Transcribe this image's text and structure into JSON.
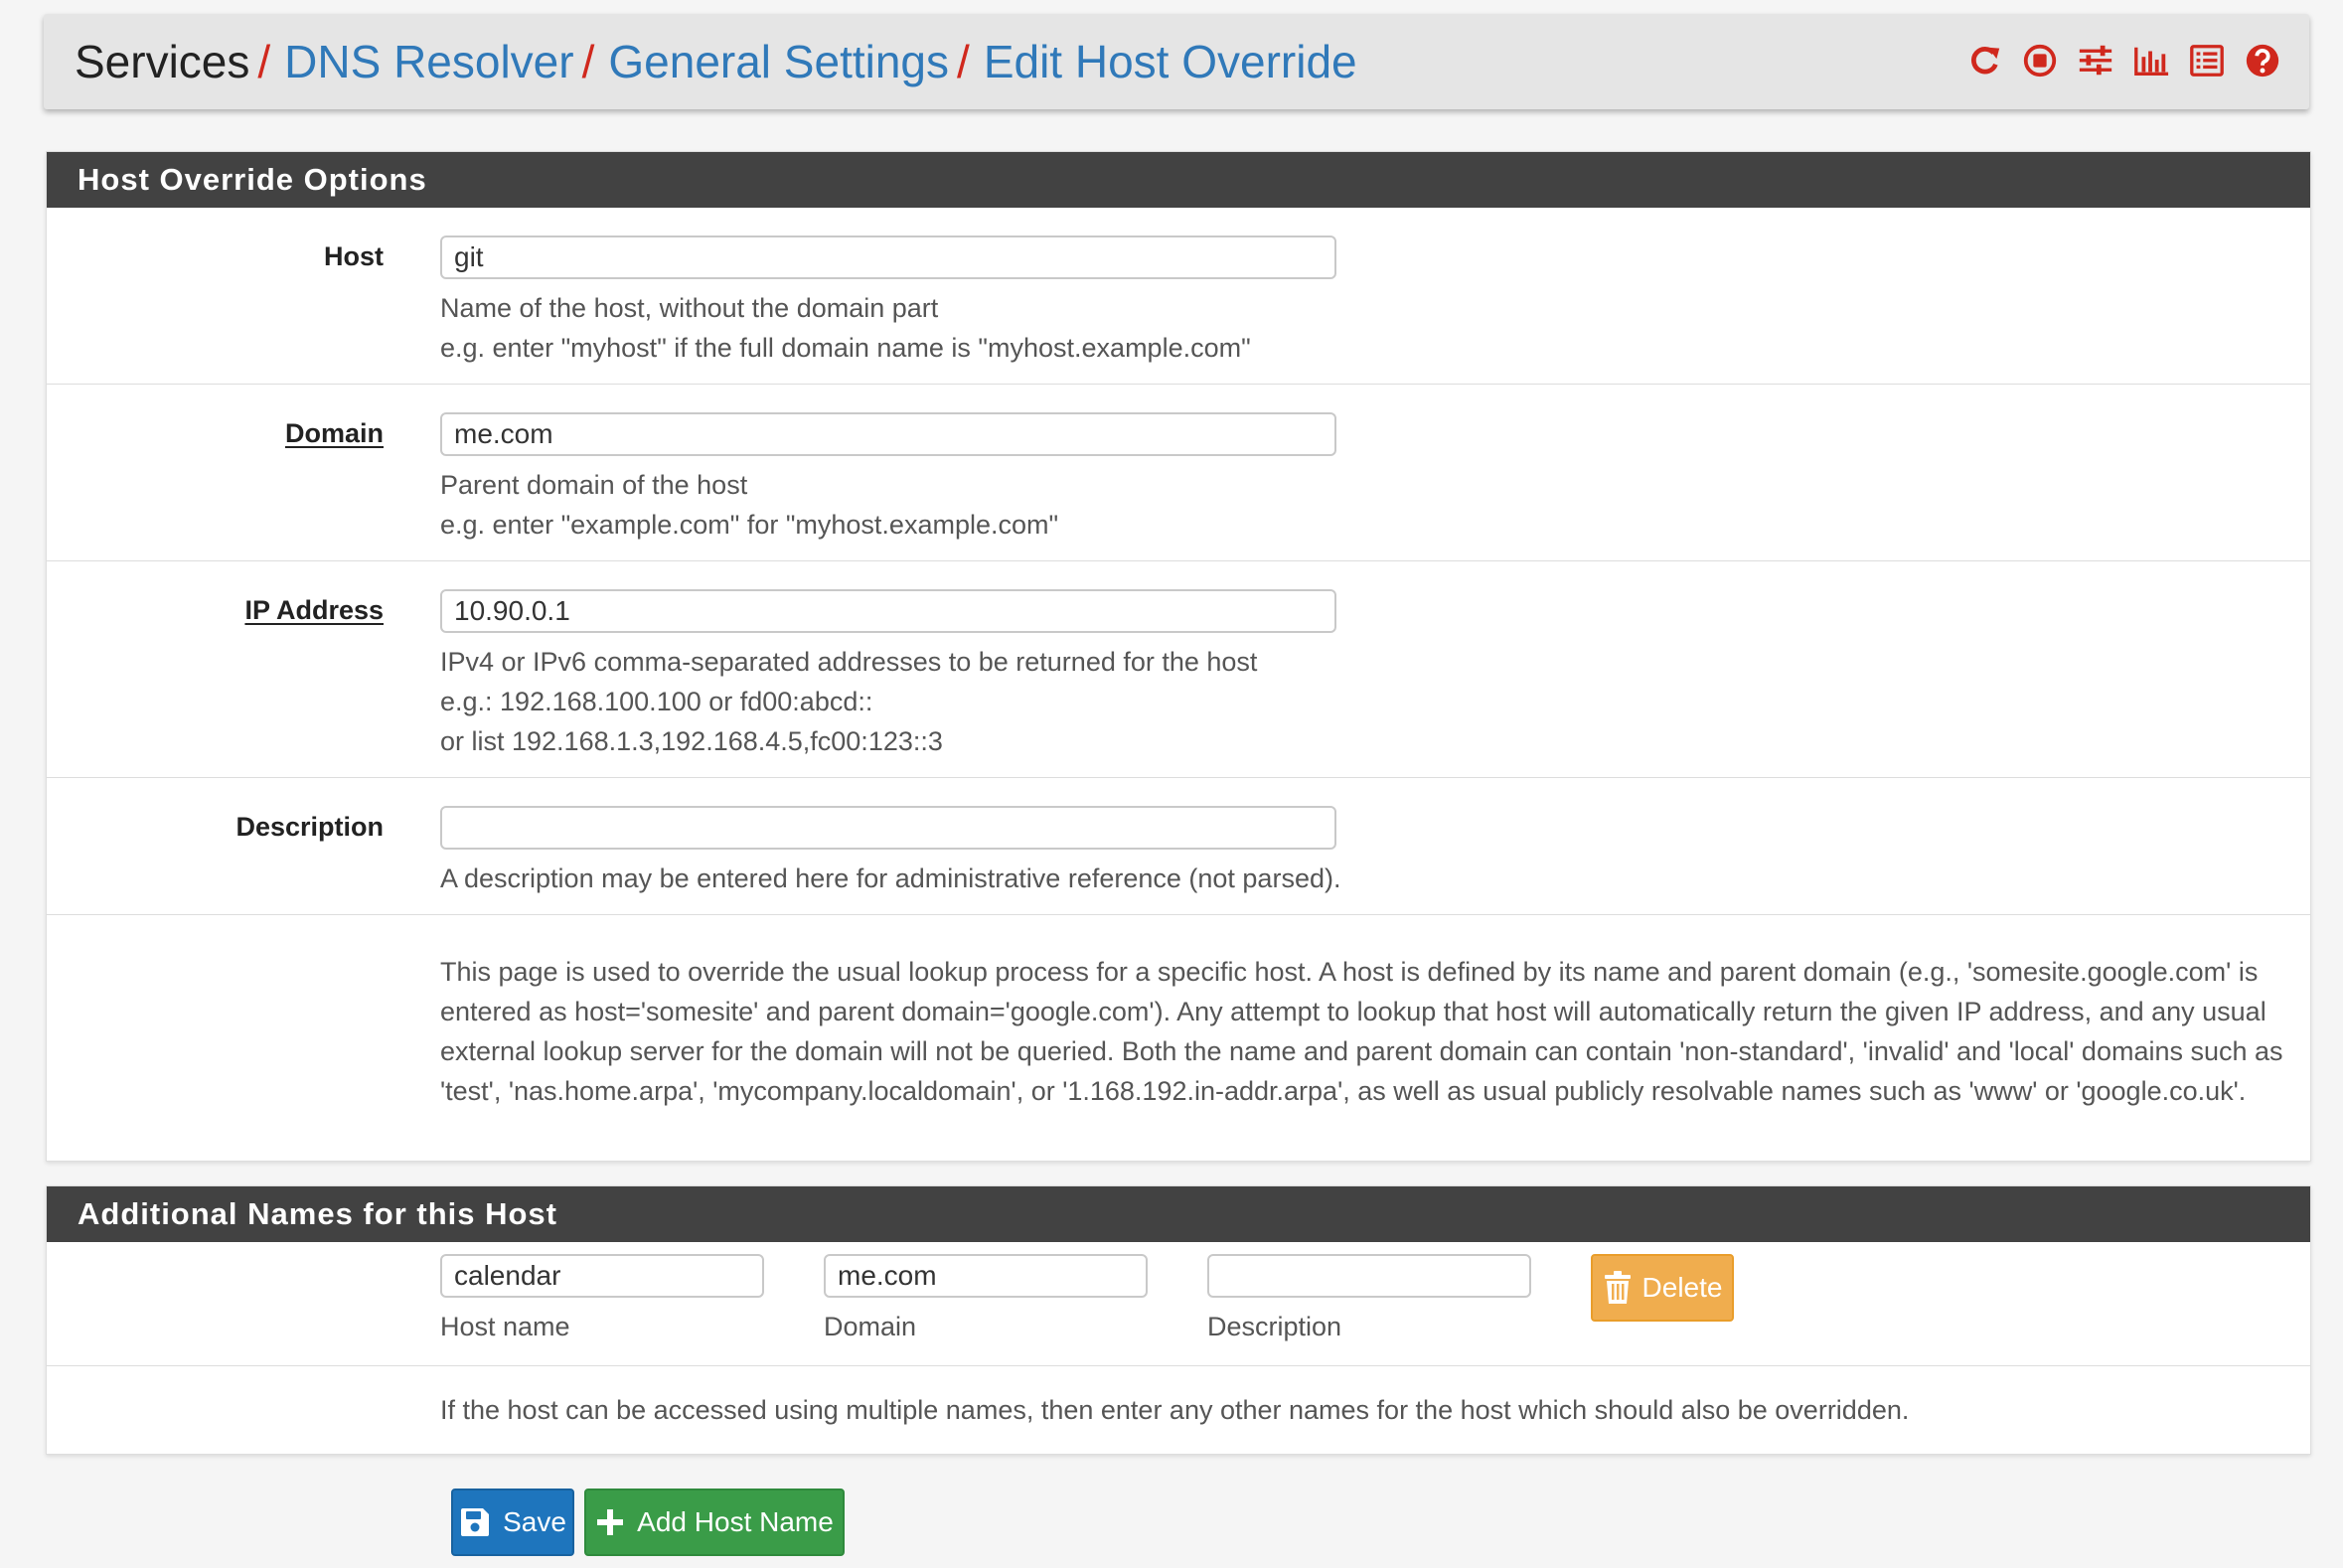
{
  "breadcrumb": {
    "items": [
      "Services",
      "DNS Resolver",
      "General Settings",
      "Edit Host Override"
    ],
    "separator": "/"
  },
  "toolbar": {
    "icons": [
      "restart-icon",
      "stop-icon",
      "settings-sliders-icon",
      "status-chart-icon",
      "log-list-icon",
      "help-icon"
    ],
    "icon_color": "#d0281d"
  },
  "host_override": {
    "heading": "Host Override Options",
    "host": {
      "label": "Host",
      "value": "git",
      "help1": "Name of the host, without the domain part",
      "help2": "e.g. enter \"myhost\" if the full domain name is \"myhost.example.com\""
    },
    "domain": {
      "label": "Domain",
      "value": "me.com",
      "help1": "Parent domain of the host",
      "help2": "e.g. enter \"example.com\" for \"myhost.example.com\""
    },
    "ip": {
      "label": "IP Address",
      "value": "10.90.0.1",
      "help1": "IPv4 or IPv6 comma-separated addresses to be returned for the host",
      "help2": "e.g.: 192.168.100.100 or fd00:abcd::",
      "help3": "or list 192.168.1.3,192.168.4.5,fc00:123::3"
    },
    "description": {
      "label": "Description",
      "value": "",
      "help": "A description may be entered here for administrative reference (not parsed)."
    },
    "info": "This page is used to override the usual lookup process for a specific host. A host is defined by its name and parent domain (e.g., 'somesite.google.com' is entered as host='somesite' and parent domain='google.com'). Any attempt to lookup that host will automatically return the given IP address, and any usual external lookup server for the domain will not be queried. Both the name and parent domain can contain 'non-standard', 'invalid' and 'local' domains such as 'test', 'nas.home.arpa', 'mycompany.localdomain', or '1.168.192.in-addr.arpa', as well as usual publicly resolvable names such as 'www' or 'google.co.uk'."
  },
  "additional": {
    "heading": "Additional Names for this Host",
    "entries": [
      {
        "hostname": "calendar",
        "domain": "me.com",
        "description": ""
      }
    ],
    "labels": {
      "hostname": "Host name",
      "domain": "Domain",
      "description": "Description"
    },
    "delete_label": "Delete",
    "info": "If the host can be accessed using multiple names, then enter any other names for the host which should also be overridden."
  },
  "actions": {
    "save_label": "Save",
    "add_label": "Add Host Name"
  },
  "colors": {
    "link": "#3079b9",
    "separator": "#d0281d",
    "panel_heading": "#424242",
    "save": "#1e75bd",
    "add": "#3a9c48",
    "delete": "#f0ad4e"
  }
}
